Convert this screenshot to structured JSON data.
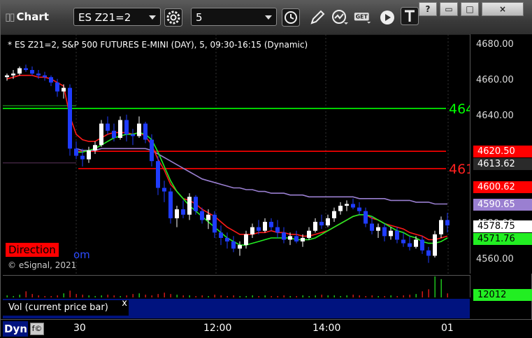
{
  "window": {
    "title": "Chart",
    "symbol": "ES Z21=2",
    "interval": "5",
    "buttons": [
      "?",
      "▭",
      "□",
      "×"
    ]
  },
  "chart_info": "* ES Z21=2, S&P 500 FUTURES E-MINI (DAY), 5, 09:30-16:15 (Dynamic)",
  "direction_label": "Direction",
  "direction_link": "om",
  "copyright": "© eSignal, 2021",
  "volume_panel_label": "Vol (current price bar)",
  "volume_close": "x",
  "volume_value": "12012",
  "bottom_label": "Dyn",
  "price_ticks": [
    "4680.00",
    "4660.00",
    "4640.00",
    "4620.00",
    "4600.00",
    "4580.00",
    "4560.00"
  ],
  "x_labels": [
    "30",
    "12:00",
    "14:00",
    "01"
  ],
  "price_labels": [
    {
      "text": "4620.50",
      "bg": "#ff0000",
      "fg": "#ffffff"
    },
    {
      "text": "4613.62",
      "bg": "#2a2a2a",
      "fg": "#ffffff"
    },
    {
      "text": "4600.62",
      "bg": "#ff0000",
      "fg": "#ffffff"
    },
    {
      "text": "4590.65",
      "bg": "#9a7fd1",
      "fg": "#ffffff"
    },
    {
      "text": "4578.75",
      "bg": "#ffffff",
      "fg": "#000000"
    },
    {
      "text": "4571.76",
      "bg": "#22ee22",
      "fg": "#000000"
    }
  ],
  "line_tags": [
    {
      "text": "464",
      "color": "#00ff00",
      "price": 4644.5
    },
    {
      "text": "461",
      "color": "#ff2020",
      "price": 4610.8
    }
  ],
  "chart_data": {
    "type": "candlestick",
    "y_range": [
      4552,
      4686
    ],
    "levels": [
      {
        "price": 4644.5,
        "color": "#00ff00"
      },
      {
        "price": 4620.5,
        "color": "#ff0000"
      },
      {
        "price": 4610.8,
        "color": "#ff0000"
      }
    ],
    "candles": [
      [
        4662,
        4664,
        4660,
        4663
      ],
      [
        4663,
        4666,
        4661,
        4664
      ],
      [
        4664,
        4668,
        4663,
        4667
      ],
      [
        4667,
        4669,
        4665,
        4666
      ],
      [
        4666,
        4668,
        4663,
        4664
      ],
      [
        4664,
        4666,
        4661,
        4663
      ],
      [
        4663,
        4665,
        4660,
        4662
      ],
      [
        4662,
        4663,
        4657,
        4659
      ],
      [
        4659,
        4661,
        4651,
        4654
      ],
      [
        4654,
        4658,
        4650,
        4656
      ],
      [
        4656,
        4658,
        4618,
        4622
      ],
      [
        4622,
        4626,
        4616,
        4618
      ],
      [
        4618,
        4622,
        4612,
        4616
      ],
      [
        4616,
        4623,
        4614,
        4621
      ],
      [
        4621,
        4626,
        4619,
        4624
      ],
      [
        4624,
        4638,
        4623,
        4636
      ],
      [
        4636,
        4640,
        4630,
        4632
      ],
      [
        4632,
        4636,
        4626,
        4628
      ],
      [
        4628,
        4640,
        4627,
        4638
      ],
      [
        4638,
        4641,
        4626,
        4630
      ],
      [
        4630,
        4633,
        4624,
        4629
      ],
      [
        4629,
        4640,
        4628,
        4636
      ],
      [
        4636,
        4637,
        4625,
        4627
      ],
      [
        4627,
        4630,
        4612,
        4615
      ],
      [
        4615,
        4618,
        4596,
        4600
      ],
      [
        4600,
        4604,
        4592,
        4598
      ],
      [
        4598,
        4600,
        4580,
        4583
      ],
      [
        4583,
        4590,
        4578,
        4588
      ],
      [
        4588,
        4593,
        4583,
        4585
      ],
      [
        4585,
        4597,
        4582,
        4595
      ],
      [
        4595,
        4596,
        4585,
        4587
      ],
      [
        4587,
        4589,
        4580,
        4582
      ],
      [
        4582,
        4588,
        4577,
        4585
      ],
      [
        4585,
        4587,
        4572,
        4575
      ],
      [
        4575,
        4579,
        4568,
        4572
      ],
      [
        4572,
        4575,
        4566,
        4570
      ],
      [
        4570,
        4573,
        4564,
        4566
      ],
      [
        4566,
        4570,
        4562,
        4568
      ],
      [
        4568,
        4576,
        4566,
        4574
      ],
      [
        4574,
        4580,
        4572,
        4578
      ],
      [
        4578,
        4582,
        4574,
        4576
      ],
      [
        4576,
        4583,
        4575,
        4581
      ],
      [
        4581,
        4583,
        4576,
        4578
      ],
      [
        4578,
        4582,
        4572,
        4575
      ],
      [
        4575,
        4578,
        4569,
        4571
      ],
      [
        4571,
        4575,
        4568,
        4573
      ],
      [
        4573,
        4576,
        4569,
        4570
      ],
      [
        4570,
        4574,
        4567,
        4572
      ],
      [
        4572,
        4578,
        4571,
        4576
      ],
      [
        4576,
        4583,
        4575,
        4581
      ],
      [
        4581,
        4585,
        4577,
        4579
      ],
      [
        4579,
        4585,
        4578,
        4583
      ],
      [
        4583,
        4589,
        4581,
        4587
      ],
      [
        4587,
        4592,
        4585,
        4590
      ],
      [
        4590,
        4593,
        4587,
        4591
      ],
      [
        4591,
        4594,
        4588,
        4589
      ],
      [
        4589,
        4592,
        4585,
        4587
      ],
      [
        4587,
        4589,
        4578,
        4580
      ],
      [
        4580,
        4584,
        4574,
        4576
      ],
      [
        4576,
        4580,
        4572,
        4578
      ],
      [
        4578,
        4580,
        4570,
        4573
      ],
      [
        4573,
        4578,
        4571,
        4576
      ],
      [
        4576,
        4578,
        4569,
        4571
      ],
      [
        4571,
        4575,
        4567,
        4569
      ],
      [
        4569,
        4573,
        4565,
        4567
      ],
      [
        4567,
        4573,
        4566,
        4571
      ],
      [
        4571,
        4573,
        4563,
        4565
      ],
      [
        4565,
        4567,
        4558,
        4562
      ],
      [
        4562,
        4576,
        4561,
        4574
      ],
      [
        4574,
        4584,
        4572,
        4582
      ],
      [
        4582,
        4586,
        4575,
        4579
      ]
    ],
    "ma_red": [
      4661,
      4662,
      4663,
      4663,
      4663,
      4662,
      4662,
      4661,
      4659,
      4657,
      4640,
      4630,
      4627,
      4626,
      4626,
      4628,
      4630,
      4631,
      4631,
      4631,
      4630,
      4631,
      4629,
      4624,
      4616,
      4610,
      4602,
      4598,
      4594,
      4593,
      4591,
      4588,
      4586,
      4584,
      4581,
      4578,
      4576,
      4574,
      4574,
      4574,
      4575,
      4575,
      4576,
      4575,
      4575,
      4574,
      4574,
      4573,
      4573,
      4574,
      4575,
      4576,
      4578,
      4580,
      4582,
      4584,
      4585,
      4585,
      4583,
      4582,
      4580,
      4579,
      4578,
      4577,
      4575,
      4574,
      4573,
      4571,
      4571,
      4572,
      4573
    ],
    "ma_green": [
      null,
      null,
      null,
      null,
      null,
      null,
      null,
      null,
      null,
      null,
      null,
      4620,
      4620,
      4621,
      4622,
      4624,
      4626,
      4628,
      4629,
      4630,
      4630,
      4631,
      4630,
      4627,
      4620,
      4612,
      4604,
      4598,
      4594,
      4590,
      4587,
      4584,
      4581,
      4578,
      4575,
      4572,
      4570,
      4568,
      4568,
      4569,
      4570,
      4571,
      4572,
      4572,
      4572,
      4572,
      4571,
      4571,
      4571,
      4572,
      4574,
      4576,
      4578,
      4580,
      4582,
      4584,
      4585,
      4585,
      4584,
      4582,
      4580,
      4578,
      4576,
      4575,
      4573,
      4572,
      4570,
      4569,
      4569,
      4570,
      4572
    ],
    "ma_purple": [
      null,
      null,
      null,
      null,
      null,
      null,
      null,
      null,
      null,
      null,
      null,
      4622,
      4621,
      4621,
      4621,
      4622,
      4622,
      4622,
      4622,
      4622,
      4622,
      4622,
      4622,
      4621,
      4619,
      4617,
      4615,
      4613,
      4611,
      4609,
      4607,
      4605,
      4604,
      4603,
      4602,
      4601,
      4600,
      4600,
      4599,
      4599,
      4598,
      4598,
      4597,
      4597,
      4597,
      4596,
      4596,
      4596,
      4595,
      4595,
      4595,
      4595,
      4595,
      4595,
      4595,
      4595,
      4594,
      4594,
      4594,
      4594,
      4594,
      4593,
      4593,
      4593,
      4593,
      4592,
      4592,
      4592,
      4591,
      4591,
      4591
    ],
    "volume": [
      3,
      2,
      4,
      9,
      5,
      3,
      2,
      2,
      3,
      6,
      10,
      5,
      4,
      3,
      2,
      3,
      4,
      3,
      2,
      3,
      5,
      6,
      4,
      3,
      5,
      7,
      5,
      4,
      3,
      3,
      2,
      3,
      2,
      4,
      3,
      2,
      3,
      2,
      2,
      3,
      2,
      3,
      2,
      2,
      3,
      2,
      2,
      3,
      2,
      3,
      4,
      3,
      3,
      2,
      3,
      4,
      3,
      2,
      3,
      2,
      2,
      3,
      2,
      3,
      4,
      5,
      9,
      12,
      31,
      27,
      6
    ]
  }
}
